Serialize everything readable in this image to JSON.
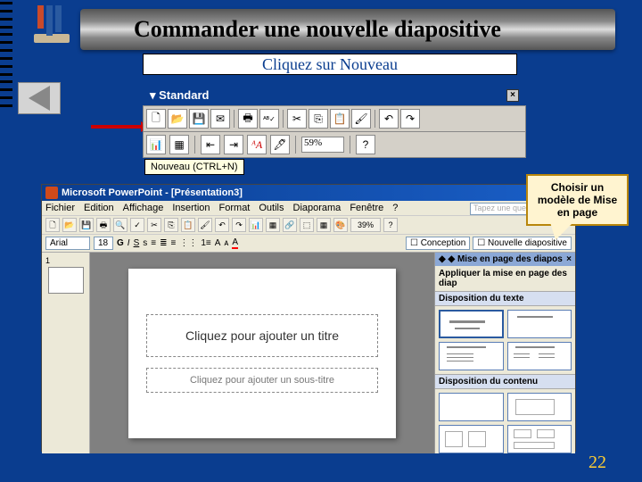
{
  "slide": {
    "title": "Commander une nouvelle diapositive",
    "subtitle": "Cliquez sur Nouveau",
    "page_number": "22"
  },
  "toolbar": {
    "handle_label": "Standard",
    "tooltip": "Nouveau (CTRL+N)",
    "zoom": "59%",
    "icons": {
      "new": "new-file-icon",
      "open": "open-folder-icon",
      "save": "save-disk-icon",
      "mail": "envelope-icon",
      "print": "printer-icon",
      "spellcheck": "spellcheck-abc-icon",
      "cut": "scissors-icon",
      "copy": "copy-icon",
      "paste": "clipboard-icon",
      "format_painter": "paintbrush-icon",
      "undo": "undo-arrow-icon",
      "redo": "redo-arrow-icon",
      "chart": "chart-icon",
      "table": "table-icon",
      "indent_less": "outdent-icon",
      "indent_more": "indent-icon",
      "font_fx": "font-a-icon",
      "zoom_help": "help-icon"
    }
  },
  "powerpoint": {
    "app_title": "Microsoft PowerPoint - [Présentation3]",
    "question_placeholder": "Tapez une question",
    "menu": [
      "Fichier",
      "Edition",
      "Affichage",
      "Insertion",
      "Format",
      "Outils",
      "Diaporama",
      "Fenêtre",
      "?"
    ],
    "format_bar": {
      "font": "Arial",
      "size": "18",
      "zoom": "39%",
      "design_btn": "Conception",
      "new_slide_btn": "Nouvelle diapositive"
    },
    "slide_placeholders": {
      "title": "Cliquez pour ajouter un titre",
      "subtitle": "Cliquez pour ajouter un sous-titre"
    },
    "task_pane": {
      "title": "Mise en page des diapos",
      "apply_label": "Appliquer la mise en page des diap",
      "section_text": "Disposition du texte",
      "section_content": "Disposition du contenu"
    }
  },
  "callout": "Choisir un modèle de Mise en page"
}
